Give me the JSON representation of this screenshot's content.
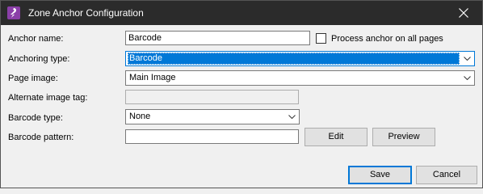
{
  "window": {
    "title": "Zone Anchor Configuration"
  },
  "icons": {
    "app": "app-logo-icon",
    "close": "close-icon",
    "dropdown": "chevron-down-icon"
  },
  "form": {
    "anchor_name": {
      "label": "Anchor name:",
      "value": "Barcode"
    },
    "process_all_pages": {
      "label": "Process anchor on all pages",
      "checked": false
    },
    "anchoring_type": {
      "label": "Anchoring type:",
      "value": "Barcode"
    },
    "page_image": {
      "label": "Page image:",
      "value": "Main Image"
    },
    "alternate_image_tag": {
      "label": "Alternate image tag:",
      "value": ""
    },
    "barcode_type": {
      "label": "Barcode type:",
      "value": "None"
    },
    "barcode_pattern": {
      "label": "Barcode pattern:",
      "value": ""
    }
  },
  "buttons": {
    "edit": "Edit",
    "preview": "Preview",
    "save": "Save",
    "cancel": "Cancel"
  },
  "colors": {
    "titlebar": "#2b2b2b",
    "accent": "#0078d7",
    "app_icon": "#8b3fa8"
  }
}
